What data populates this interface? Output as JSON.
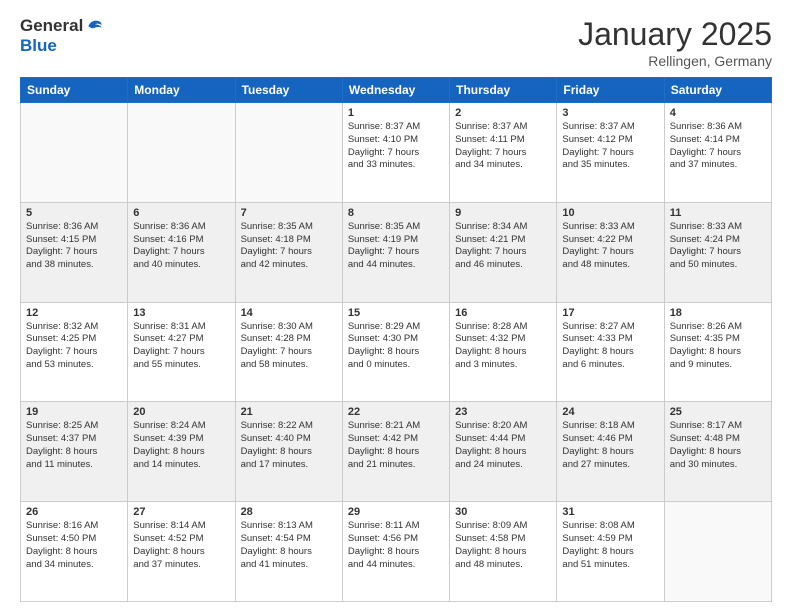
{
  "header": {
    "logo_general": "General",
    "logo_blue": "Blue",
    "month_title": "January 2025",
    "location": "Rellingen, Germany"
  },
  "weekdays": [
    "Sunday",
    "Monday",
    "Tuesday",
    "Wednesday",
    "Thursday",
    "Friday",
    "Saturday"
  ],
  "weeks": [
    [
      {
        "day": "",
        "info": "",
        "empty": true
      },
      {
        "day": "",
        "info": "",
        "empty": true
      },
      {
        "day": "",
        "info": "",
        "empty": true
      },
      {
        "day": "1",
        "info": "Sunrise: 8:37 AM\nSunset: 4:10 PM\nDaylight: 7 hours\nand 33 minutes.",
        "empty": false
      },
      {
        "day": "2",
        "info": "Sunrise: 8:37 AM\nSunset: 4:11 PM\nDaylight: 7 hours\nand 34 minutes.",
        "empty": false
      },
      {
        "day": "3",
        "info": "Sunrise: 8:37 AM\nSunset: 4:12 PM\nDaylight: 7 hours\nand 35 minutes.",
        "empty": false
      },
      {
        "day": "4",
        "info": "Sunrise: 8:36 AM\nSunset: 4:14 PM\nDaylight: 7 hours\nand 37 minutes.",
        "empty": false
      }
    ],
    [
      {
        "day": "5",
        "info": "Sunrise: 8:36 AM\nSunset: 4:15 PM\nDaylight: 7 hours\nand 38 minutes.",
        "empty": false,
        "shaded": true
      },
      {
        "day": "6",
        "info": "Sunrise: 8:36 AM\nSunset: 4:16 PM\nDaylight: 7 hours\nand 40 minutes.",
        "empty": false,
        "shaded": true
      },
      {
        "day": "7",
        "info": "Sunrise: 8:35 AM\nSunset: 4:18 PM\nDaylight: 7 hours\nand 42 minutes.",
        "empty": false,
        "shaded": true
      },
      {
        "day": "8",
        "info": "Sunrise: 8:35 AM\nSunset: 4:19 PM\nDaylight: 7 hours\nand 44 minutes.",
        "empty": false,
        "shaded": true
      },
      {
        "day": "9",
        "info": "Sunrise: 8:34 AM\nSunset: 4:21 PM\nDaylight: 7 hours\nand 46 minutes.",
        "empty": false,
        "shaded": true
      },
      {
        "day": "10",
        "info": "Sunrise: 8:33 AM\nSunset: 4:22 PM\nDaylight: 7 hours\nand 48 minutes.",
        "empty": false,
        "shaded": true
      },
      {
        "day": "11",
        "info": "Sunrise: 8:33 AM\nSunset: 4:24 PM\nDaylight: 7 hours\nand 50 minutes.",
        "empty": false,
        "shaded": true
      }
    ],
    [
      {
        "day": "12",
        "info": "Sunrise: 8:32 AM\nSunset: 4:25 PM\nDaylight: 7 hours\nand 53 minutes.",
        "empty": false
      },
      {
        "day": "13",
        "info": "Sunrise: 8:31 AM\nSunset: 4:27 PM\nDaylight: 7 hours\nand 55 minutes.",
        "empty": false
      },
      {
        "day": "14",
        "info": "Sunrise: 8:30 AM\nSunset: 4:28 PM\nDaylight: 7 hours\nand 58 minutes.",
        "empty": false
      },
      {
        "day": "15",
        "info": "Sunrise: 8:29 AM\nSunset: 4:30 PM\nDaylight: 8 hours\nand 0 minutes.",
        "empty": false
      },
      {
        "day": "16",
        "info": "Sunrise: 8:28 AM\nSunset: 4:32 PM\nDaylight: 8 hours\nand 3 minutes.",
        "empty": false
      },
      {
        "day": "17",
        "info": "Sunrise: 8:27 AM\nSunset: 4:33 PM\nDaylight: 8 hours\nand 6 minutes.",
        "empty": false
      },
      {
        "day": "18",
        "info": "Sunrise: 8:26 AM\nSunset: 4:35 PM\nDaylight: 8 hours\nand 9 minutes.",
        "empty": false
      }
    ],
    [
      {
        "day": "19",
        "info": "Sunrise: 8:25 AM\nSunset: 4:37 PM\nDaylight: 8 hours\nand 11 minutes.",
        "empty": false,
        "shaded": true
      },
      {
        "day": "20",
        "info": "Sunrise: 8:24 AM\nSunset: 4:39 PM\nDaylight: 8 hours\nand 14 minutes.",
        "empty": false,
        "shaded": true
      },
      {
        "day": "21",
        "info": "Sunrise: 8:22 AM\nSunset: 4:40 PM\nDaylight: 8 hours\nand 17 minutes.",
        "empty": false,
        "shaded": true
      },
      {
        "day": "22",
        "info": "Sunrise: 8:21 AM\nSunset: 4:42 PM\nDaylight: 8 hours\nand 21 minutes.",
        "empty": false,
        "shaded": true
      },
      {
        "day": "23",
        "info": "Sunrise: 8:20 AM\nSunset: 4:44 PM\nDaylight: 8 hours\nand 24 minutes.",
        "empty": false,
        "shaded": true
      },
      {
        "day": "24",
        "info": "Sunrise: 8:18 AM\nSunset: 4:46 PM\nDaylight: 8 hours\nand 27 minutes.",
        "empty": false,
        "shaded": true
      },
      {
        "day": "25",
        "info": "Sunrise: 8:17 AM\nSunset: 4:48 PM\nDaylight: 8 hours\nand 30 minutes.",
        "empty": false,
        "shaded": true
      }
    ],
    [
      {
        "day": "26",
        "info": "Sunrise: 8:16 AM\nSunset: 4:50 PM\nDaylight: 8 hours\nand 34 minutes.",
        "empty": false
      },
      {
        "day": "27",
        "info": "Sunrise: 8:14 AM\nSunset: 4:52 PM\nDaylight: 8 hours\nand 37 minutes.",
        "empty": false
      },
      {
        "day": "28",
        "info": "Sunrise: 8:13 AM\nSunset: 4:54 PM\nDaylight: 8 hours\nand 41 minutes.",
        "empty": false
      },
      {
        "day": "29",
        "info": "Sunrise: 8:11 AM\nSunset: 4:56 PM\nDaylight: 8 hours\nand 44 minutes.",
        "empty": false
      },
      {
        "day": "30",
        "info": "Sunrise: 8:09 AM\nSunset: 4:58 PM\nDaylight: 8 hours\nand 48 minutes.",
        "empty": false
      },
      {
        "day": "31",
        "info": "Sunrise: 8:08 AM\nSunset: 4:59 PM\nDaylight: 8 hours\nand 51 minutes.",
        "empty": false
      },
      {
        "day": "",
        "info": "",
        "empty": true
      }
    ]
  ]
}
